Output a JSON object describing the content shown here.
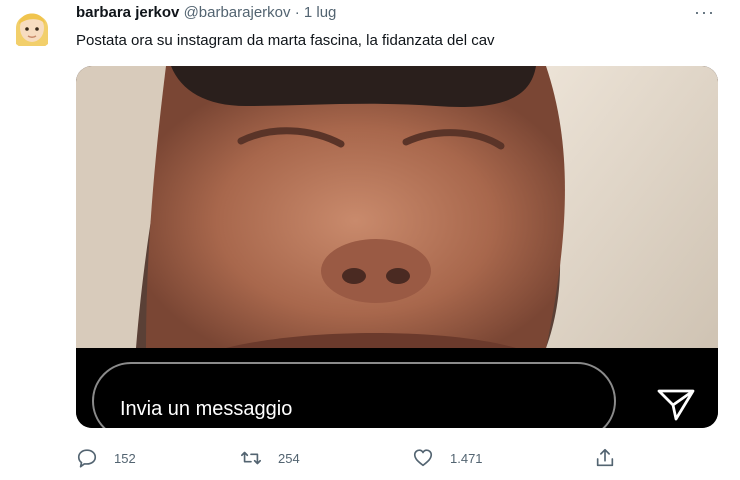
{
  "tweet": {
    "author_name": "barbara jerkov",
    "author_handle": "@barbarajerkov",
    "separator": "·",
    "date": "1 lug",
    "more_label": "···",
    "text": "Postata ora su instagram da marta fascina, la fidanzata del cav",
    "avatar_icon": "blonde-woman-emoji-icon"
  },
  "media": {
    "message_placeholder": "Invia un messaggio",
    "send_icon": "paper-plane-icon"
  },
  "actions": {
    "reply_count": "152",
    "retweet_count": "254",
    "like_count": "1.471",
    "share_icon": "share-icon"
  },
  "colors": {
    "text_primary": "#0f1419",
    "text_secondary": "#536471",
    "story_bar": "#000000"
  }
}
